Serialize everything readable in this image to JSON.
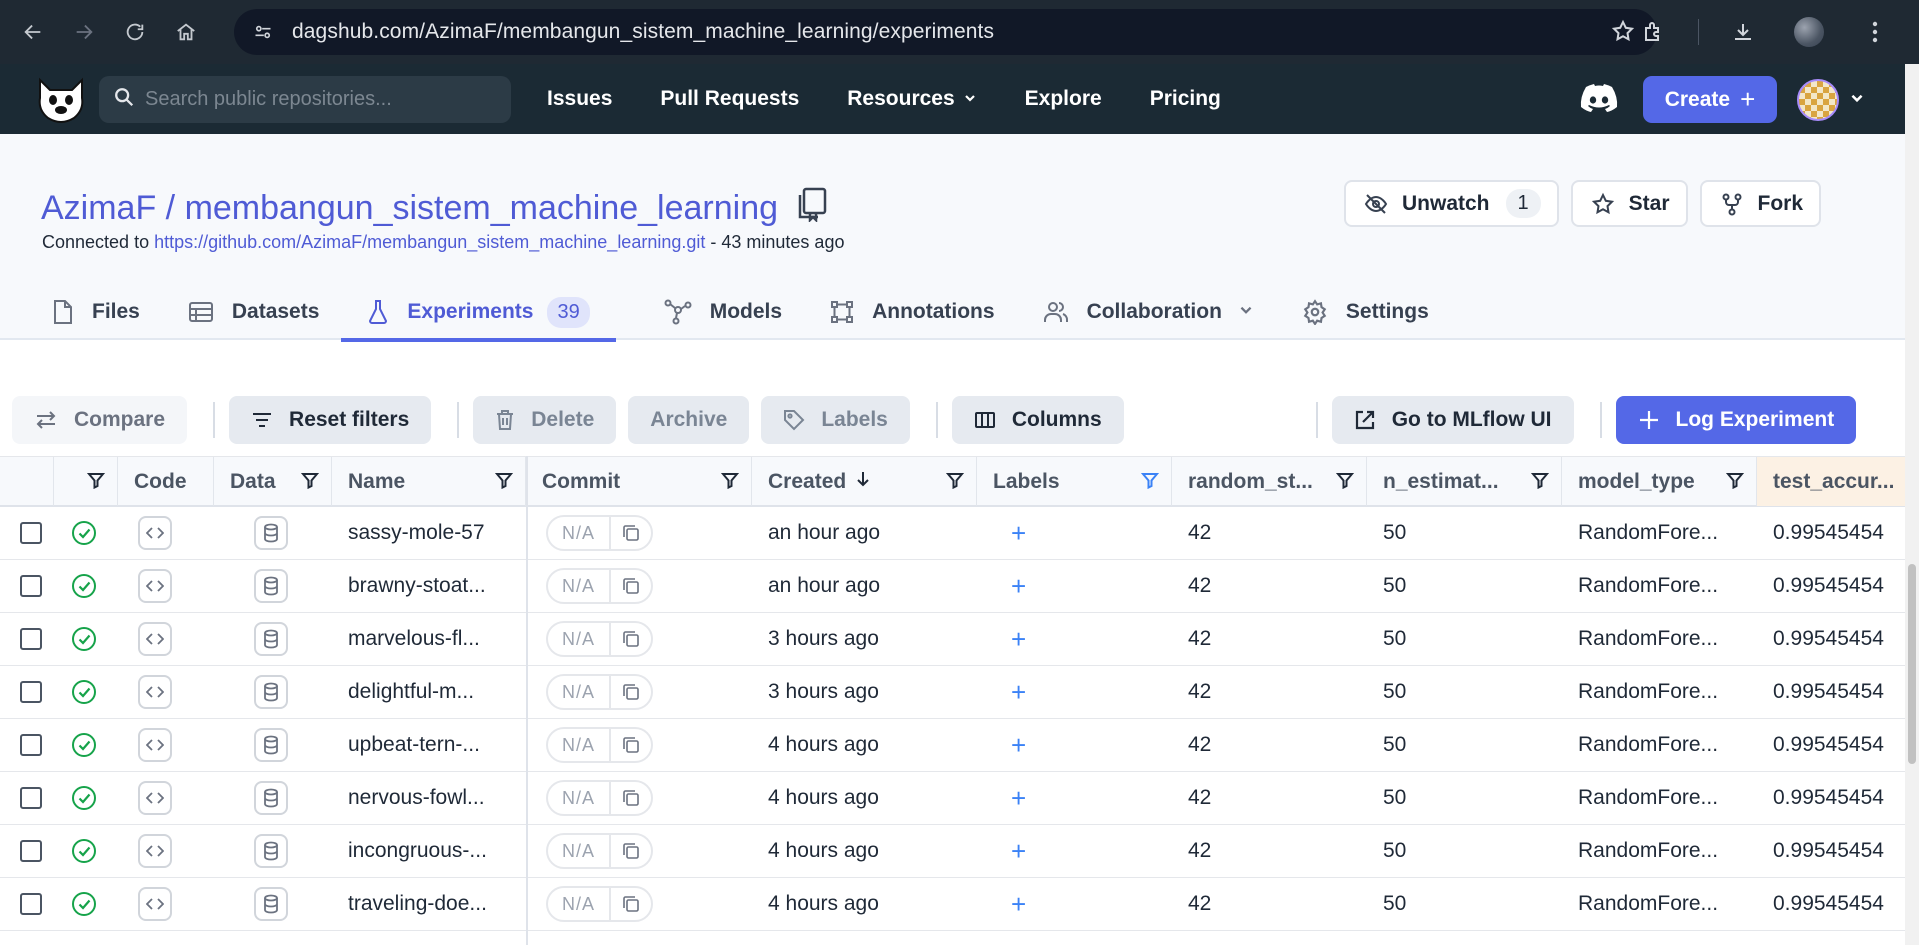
{
  "browser": {
    "url": "dagshub.com/AzimaF/membangun_sistem_machine_learning/experiments"
  },
  "header": {
    "search_placeholder": "Search public repositories...",
    "nav": [
      "Issues",
      "Pull Requests",
      "Resources",
      "Explore",
      "Pricing"
    ],
    "create_label": "Create",
    "create_plus": "+"
  },
  "repo": {
    "title": "AzimaF / membangun_sistem_machine_learning",
    "connected_prefix": "Connected to",
    "repo_url": "https://github.com/AzimaF/membangun_sistem_machine_learning.git",
    "updated": "- 43 minutes ago",
    "unwatch_label": "Unwatch",
    "watch_count": "1",
    "star_label": "Star",
    "fork_label": "Fork"
  },
  "tabs": [
    {
      "label": "Files"
    },
    {
      "label": "Datasets"
    },
    {
      "label": "Experiments",
      "badge": "39"
    },
    {
      "label": "Models"
    },
    {
      "label": "Annotations"
    },
    {
      "label": "Collaboration"
    },
    {
      "label": "Settings"
    }
  ],
  "toolbar": {
    "compare": "Compare",
    "reset_filters": "Reset filters",
    "delete": "Delete",
    "archive": "Archive",
    "labels": "Labels",
    "columns": "Columns",
    "mlflow": "Go to MLflow UI",
    "log_experiment": "Log Experiment"
  },
  "table": {
    "headers": {
      "code": "Code",
      "data": "Data",
      "name": "Name",
      "commit": "Commit",
      "created": "Created",
      "labels": "Labels",
      "random_state": "random_st...",
      "n_estimators": "n_estimat...",
      "model_type": "model_type",
      "test_accuracy": "test_accur..."
    },
    "rows": [
      {
        "name": "sassy-mole-57",
        "commit": "N/A",
        "created": "an hour ago",
        "random_state": "42",
        "n_estimators": "50",
        "model_type": "RandomFore...",
        "test_accuracy": "0.99545454"
      },
      {
        "name": "brawny-stoat...",
        "commit": "N/A",
        "created": "an hour ago",
        "random_state": "42",
        "n_estimators": "50",
        "model_type": "RandomFore...",
        "test_accuracy": "0.99545454"
      },
      {
        "name": "marvelous-fl...",
        "commit": "N/A",
        "created": "3 hours ago",
        "random_state": "42",
        "n_estimators": "50",
        "model_type": "RandomFore...",
        "test_accuracy": "0.99545454"
      },
      {
        "name": "delightful-m...",
        "commit": "N/A",
        "created": "3 hours ago",
        "random_state": "42",
        "n_estimators": "50",
        "model_type": "RandomFore...",
        "test_accuracy": "0.99545454"
      },
      {
        "name": "upbeat-tern-...",
        "commit": "N/A",
        "created": "4 hours ago",
        "random_state": "42",
        "n_estimators": "50",
        "model_type": "RandomFore...",
        "test_accuracy": "0.99545454"
      },
      {
        "name": "nervous-fowl...",
        "commit": "N/A",
        "created": "4 hours ago",
        "random_state": "42",
        "n_estimators": "50",
        "model_type": "RandomFore...",
        "test_accuracy": "0.99545454"
      },
      {
        "name": "incongruous-...",
        "commit": "N/A",
        "created": "4 hours ago",
        "random_state": "42",
        "n_estimators": "50",
        "model_type": "RandomFore...",
        "test_accuracy": "0.99545454"
      },
      {
        "name": "traveling-doe...",
        "commit": "N/A",
        "created": "4 hours ago",
        "random_state": "42",
        "n_estimators": "50",
        "model_type": "RandomFore...",
        "test_accuracy": "0.99545454"
      }
    ],
    "label_add": "+"
  },
  "colors": {
    "accent": "#5468e7",
    "header_bg": "#1b2a34",
    "success": "#16a34a",
    "metric_header_bg": "#fcf1e4"
  }
}
